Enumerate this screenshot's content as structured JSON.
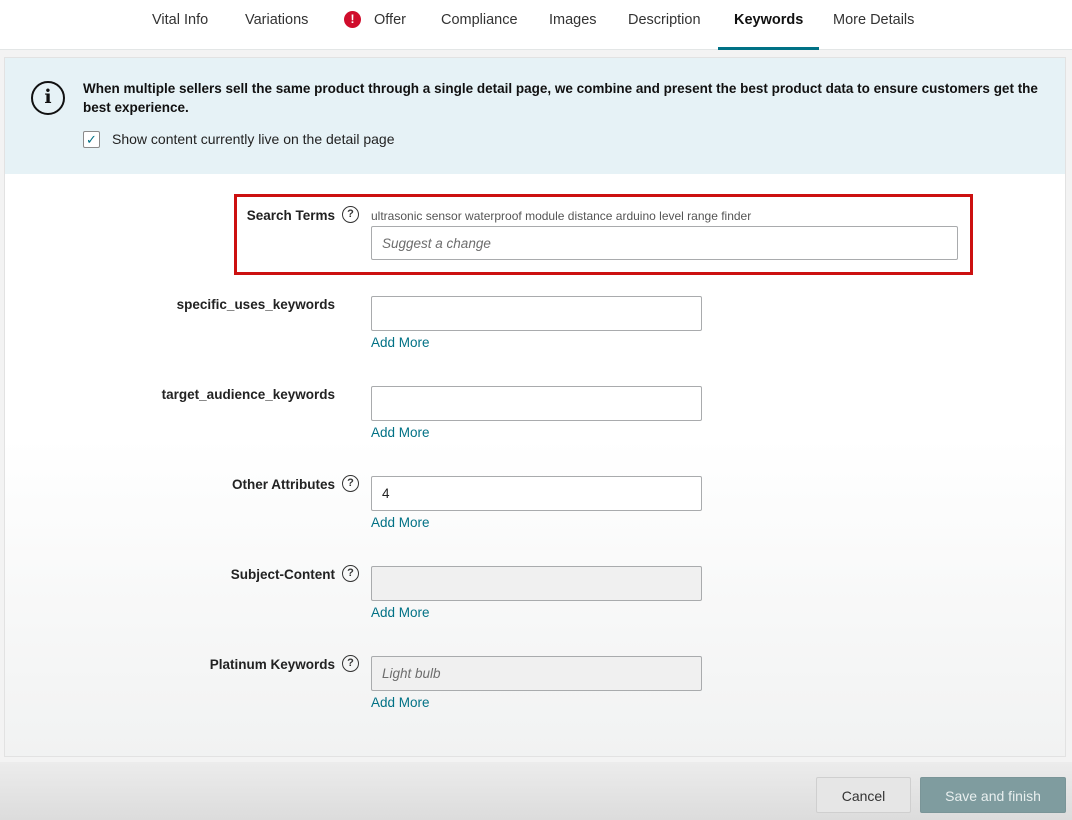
{
  "tabs": [
    {
      "label": "Vital Info",
      "active": false
    },
    {
      "label": "Variations",
      "active": false
    },
    {
      "label": "Offer",
      "active": false,
      "alert": true
    },
    {
      "label": "Compliance",
      "active": false
    },
    {
      "label": "Images",
      "active": false
    },
    {
      "label": "Description",
      "active": false
    },
    {
      "label": "Keywords",
      "active": true
    },
    {
      "label": "More Details",
      "active": false
    }
  ],
  "alert_badge": "!",
  "info": {
    "icon": "info-icon",
    "icon_glyph": "i",
    "message": "When multiple sellers sell the same product through a single detail page, we combine and present the best product data to ensure customers get the best experience.",
    "checkbox_checked": true,
    "checkbox_glyph": "✓",
    "checkbox_label": "Show content currently live on the detail page"
  },
  "help_glyph": "?",
  "fields": {
    "search_terms": {
      "label": "Search Terms",
      "current_value": "ultrasonic sensor waterproof module distance arduino level range finder",
      "placeholder": "Suggest a change",
      "value": ""
    },
    "specific_uses": {
      "label": "specific_uses_keywords",
      "value": "",
      "add_more": "Add More"
    },
    "target_audience": {
      "label": "target_audience_keywords",
      "value": "",
      "add_more": "Add More"
    },
    "other_attributes": {
      "label": "Other Attributes",
      "value": "4",
      "add_more": "Add More"
    },
    "subject_content": {
      "label": "Subject-Content",
      "value": "",
      "add_more": "Add More",
      "disabled": true
    },
    "platinum_keywords": {
      "label": "Platinum Keywords",
      "placeholder": "Light bulb",
      "value": "",
      "add_more": "Add More",
      "disabled": true
    }
  },
  "footer": {
    "cancel_label": "Cancel",
    "save_label": "Save and finish"
  },
  "colors": {
    "accent": "#007185",
    "highlight_border": "#cc1010",
    "alert": "#d00d2c",
    "info_background": "#e6f2f6",
    "save_button": "#7f9c9f"
  }
}
